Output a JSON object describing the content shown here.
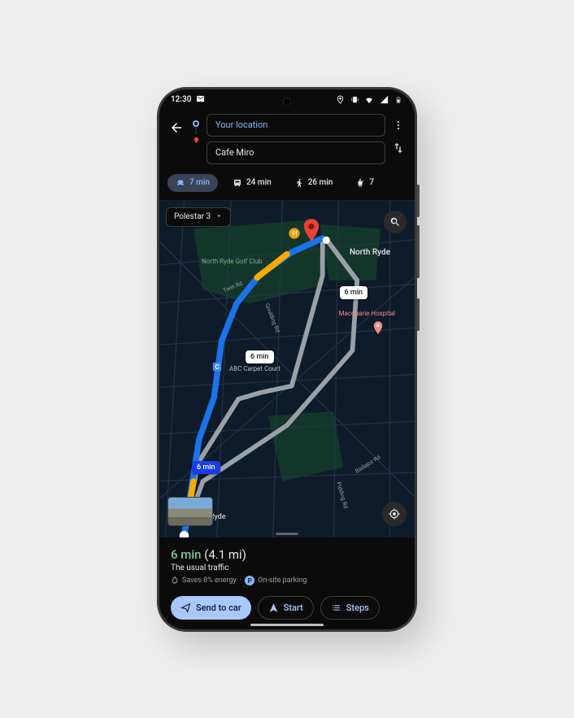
{
  "status": {
    "time": "12:30"
  },
  "search": {
    "origin_placeholder": "Your location",
    "destination_value": "Cafe Miro"
  },
  "modes": {
    "driving": "7 min",
    "transit": "24 min",
    "walking": "26 min",
    "rideshare": "7"
  },
  "vehicle": {
    "name": "Polestar 3"
  },
  "route_labels": {
    "primary": "6 min",
    "alt1": "6 min",
    "alt2": "6 min"
  },
  "poi": {
    "golf": "North Ryde Golf Club",
    "northryde": "North Ryde",
    "hospital": "Macquarie Hospital",
    "carpet": "ABC Carpet Court",
    "twin_rd": "Twin Rd",
    "goulding_rd": "Goulding Rd",
    "badajoz_rd": "Badajoz Rd",
    "pidding_rd": "Pidding Rd",
    "ryde": "Ryde"
  },
  "sheet": {
    "duration": "6 min",
    "distance": "(4.1 mi)",
    "traffic": "The usual traffic",
    "energy_savings": "Saves 8% energy",
    "parking": "On-site parking"
  },
  "actions": {
    "send_to_car": "Send to car",
    "start": "Start",
    "steps": "Steps"
  }
}
